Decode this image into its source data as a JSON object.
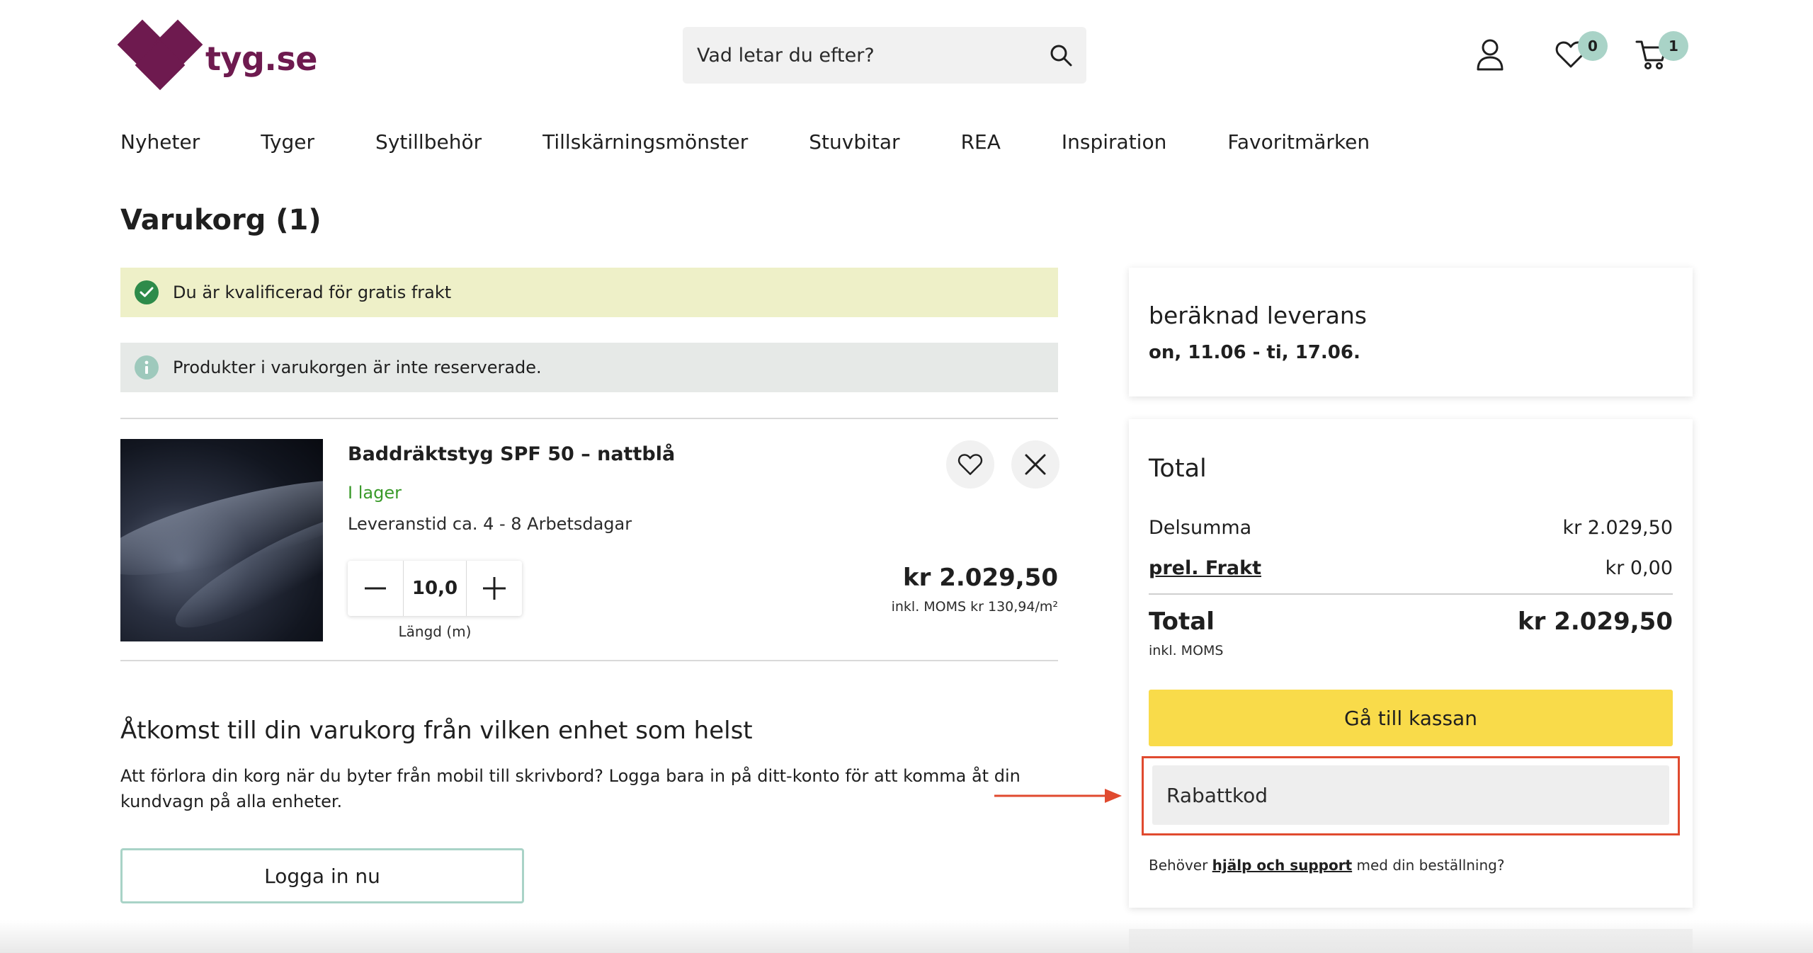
{
  "brand": {
    "name": "tyg.se",
    "color": "#6e1a4f"
  },
  "search": {
    "placeholder": "Vad letar du efter?",
    "icon": "search-icon"
  },
  "header_icons": {
    "account": "user-icon",
    "wishlist": {
      "icon": "heart-icon",
      "count": "0"
    },
    "cart": {
      "icon": "cart-icon",
      "count": "1"
    },
    "badge_color": "#a9d3c7"
  },
  "nav": [
    "Nyheter",
    "Tyger",
    "Sytillbehör",
    "Tillskärningsmönster",
    "Stuvbitar",
    "REA",
    "Inspiration",
    "Favoritmärken"
  ],
  "page": {
    "title": "Varukorg (1)"
  },
  "notices": {
    "free_shipping": "Du är kvalificerad för gratis frakt",
    "not_reserved": "Produkter i varukorgen är inte reserverade."
  },
  "cart_item": {
    "name": "Baddräktstyg SPF 50 – nattblå",
    "stock": "I lager",
    "delivery": "Leveranstid ca. 4 - 8 Arbetsdagar",
    "quantity": "10,0",
    "quantity_label": "Längd (m)",
    "price": "kr 2.029,50",
    "price_detail": "inkl. MOMS kr 130,94/m²"
  },
  "access": {
    "title": "Åtkomst till din varukorg från vilken enhet som helst",
    "text": "Att förlora din korg när du byter från mobil till skrivbord? Logga bara in på ditt-konto för att komma åt din kundvagn på alla enheter.",
    "button": "Logga in nu"
  },
  "delivery_card": {
    "label": "beräknad leverans",
    "value": "on, 11.06 - ti, 17.06."
  },
  "totals": {
    "title": "Total",
    "subtotal_label": "Delsumma",
    "subtotal_value": "kr 2.029,50",
    "shipping_label": "prel. Frakt",
    "shipping_value": "kr 0,00",
    "total_label": "Total",
    "total_value": "kr 2.029,50",
    "incl": "inkl. MOMS",
    "checkout": "Gå till kassan",
    "coupon_placeholder": "Rabattkod",
    "help_prefix": "Behöver ",
    "help_link": "hjälp och support",
    "help_suffix": " med din beställning?"
  },
  "colors": {
    "checkout": "#f9db4a",
    "highlight": "#e04a2f",
    "in_stock": "#3a9a2a",
    "success_bg": "#eef0c8",
    "info_bg": "#e6e9e7"
  }
}
